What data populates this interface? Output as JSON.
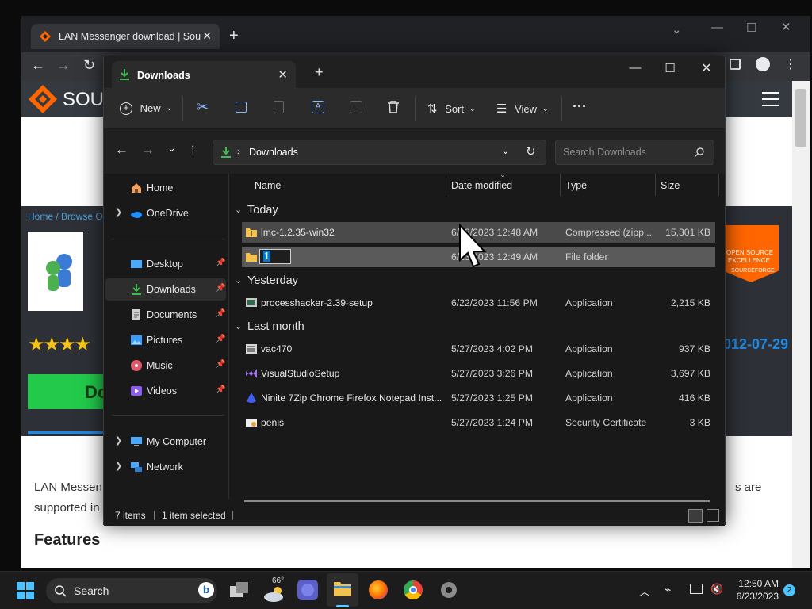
{
  "browser": {
    "tab_title": "LAN Messenger download | Sou",
    "site_brand": "SOU",
    "breadcrumb": "Home / Browse Op",
    "download_label": "Do",
    "date_partial": "012-07-29",
    "badge_line1": "OPEN SOURCE",
    "badge_line2": "EXCELLENCE",
    "badge_line3": "SOURCEFORGE",
    "desc_line1": "LAN Messen",
    "desc_line2": "supported in",
    "desc_right": "s are",
    "features_heading": "Features"
  },
  "explorer": {
    "tab_title": "Downloads",
    "toolbar": {
      "new_label": "New",
      "sort_label": "Sort",
      "view_label": "View",
      "more_label": "···"
    },
    "address": {
      "path_label": "Downloads",
      "search_placeholder": "Search Downloads"
    },
    "nav": {
      "home": "Home",
      "onedrive": "OneDrive",
      "desktop": "Desktop",
      "downloads": "Downloads",
      "documents": "Documents",
      "pictures": "Pictures",
      "music": "Music",
      "videos": "Videos",
      "my_computer": "My Computer",
      "network": "Network"
    },
    "columns": {
      "name": "Name",
      "date": "Date modified",
      "type": "Type",
      "size": "Size"
    },
    "groups": {
      "today": "Today",
      "yesterday": "Yesterday",
      "last_month": "Last month"
    },
    "files": [
      {
        "name": "lmc-1.2.35-win32",
        "date": "6/23/2023 12:48 AM",
        "type": "Compressed (zipp...",
        "size": "15,301 KB"
      },
      {
        "name": "",
        "date": "6/23/2023 12:49 AM",
        "type": "File folder",
        "size": "",
        "rename_text": "1"
      },
      {
        "name": "processhacker-2.39-setup",
        "date": "6/22/2023 11:56 PM",
        "type": "Application",
        "size": "2,215 KB"
      },
      {
        "name": "vac470",
        "date": "5/27/2023 4:02 PM",
        "type": "Application",
        "size": "937 KB"
      },
      {
        "name": "VisualStudioSetup",
        "date": "5/27/2023 3:26 PM",
        "type": "Application",
        "size": "3,697 KB"
      },
      {
        "name": "Ninite 7Zip Chrome Firefox Notepad Inst...",
        "date": "5/27/2023 1:25 PM",
        "type": "Application",
        "size": "416 KB"
      },
      {
        "name": "penis",
        "date": "5/27/2023 1:24 PM",
        "type": "Security Certificate",
        "size": "3 KB"
      }
    ],
    "status": {
      "items": "7 items",
      "selected": "1 item selected"
    }
  },
  "taskbar": {
    "search_label": "Search",
    "weather_temp": "66°",
    "time": "12:50 AM",
    "date": "6/23/2023",
    "notification_count": "2"
  },
  "colors": {
    "accent": "#0078d4",
    "downloads_green": "#3fb950",
    "sf_orange": "#ff6600"
  }
}
